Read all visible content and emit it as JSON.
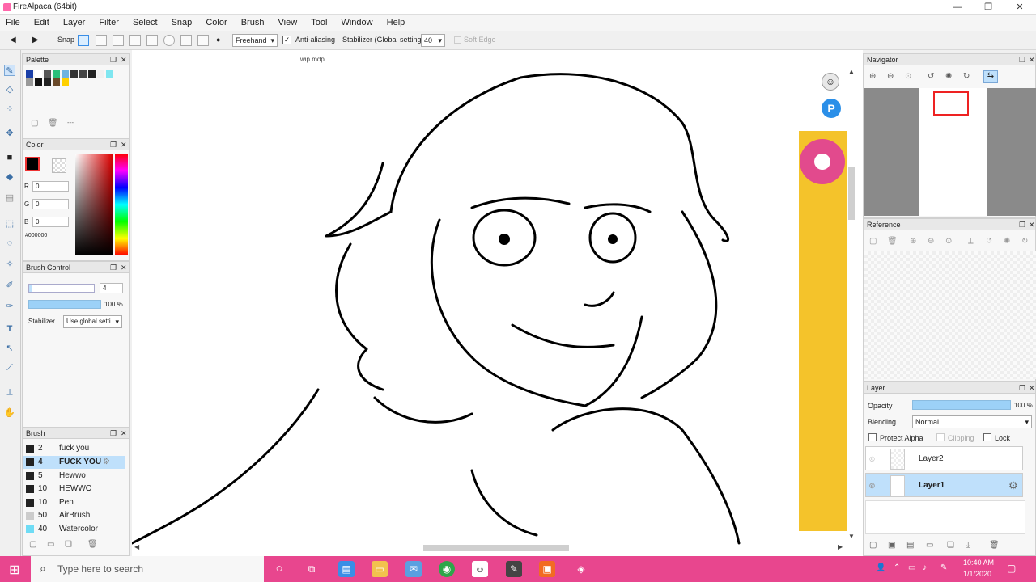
{
  "window": {
    "title": "FireAlpaca (64bit)",
    "controls": [
      "—",
      "❐",
      "✕"
    ]
  },
  "menu": [
    "File",
    "Edit",
    "Layer",
    "Filter",
    "Select",
    "Snap",
    "Color",
    "Brush",
    "View",
    "Tool",
    "Window",
    "Help"
  ],
  "toolbar": {
    "snap_label": "Snap",
    "freehand_value": "Freehand",
    "antialias_label": "Anti-aliasing",
    "stabilizer_label": "Stabilizer (Global settings)",
    "stabilizer_value": "40",
    "soft_edge_label": "Soft Edge"
  },
  "document": {
    "name": "wip.mdp"
  },
  "palette": {
    "title": "Palette",
    "colors": [
      "#1a3fa8",
      "#ffffff",
      "#555555",
      "#2bbf7a",
      "#6fb3e0",
      "#333333",
      "#444444",
      "#222222",
      "#f0f0f0",
      "#7fe6f0",
      "#999999",
      "#111111",
      "#222222",
      "#6b4a2a",
      "#ffd000"
    ],
    "footer_dash": "---"
  },
  "color": {
    "title": "Color",
    "r_label": "R",
    "r_value": "0",
    "g_label": "G",
    "g_value": "0",
    "b_label": "B",
    "b_value": "0",
    "hex": "#000000",
    "primary": "#000000"
  },
  "brush_control": {
    "title": "Brush Control",
    "size_value": "4",
    "opacity_value": "100 %",
    "stabilizer_label": "Stabilizer",
    "stabilizer_value": "Use global setti"
  },
  "brush": {
    "title": "Brush",
    "items": [
      {
        "size": "2",
        "name": "fuck you"
      },
      {
        "size": "4",
        "name": "FUCK YOU"
      },
      {
        "size": "5",
        "name": "Hewwo"
      },
      {
        "size": "10",
        "name": "HEWWO"
      },
      {
        "size": "10",
        "name": "Pen"
      },
      {
        "size": "50",
        "name": "AirBrush"
      },
      {
        "size": "40",
        "name": "Watercolor"
      }
    ]
  },
  "navigator": {
    "title": "Navigator"
  },
  "reference": {
    "title": "Reference"
  },
  "layer": {
    "title": "Layer",
    "opacity_label": "Opacity",
    "opacity_value": "100 %",
    "blending_label": "Blending",
    "blending_value": "Normal",
    "protect_alpha_label": "Protect Alpha",
    "clipping_label": "Clipping",
    "lock_label": "Lock",
    "layers": [
      {
        "name": "Layer2"
      },
      {
        "name": "Layer1"
      }
    ]
  },
  "taskbar": {
    "search_placeholder": "Type here to search",
    "time": "10:40 AM",
    "date": "1/1/2020",
    "color": "#e8468e"
  }
}
